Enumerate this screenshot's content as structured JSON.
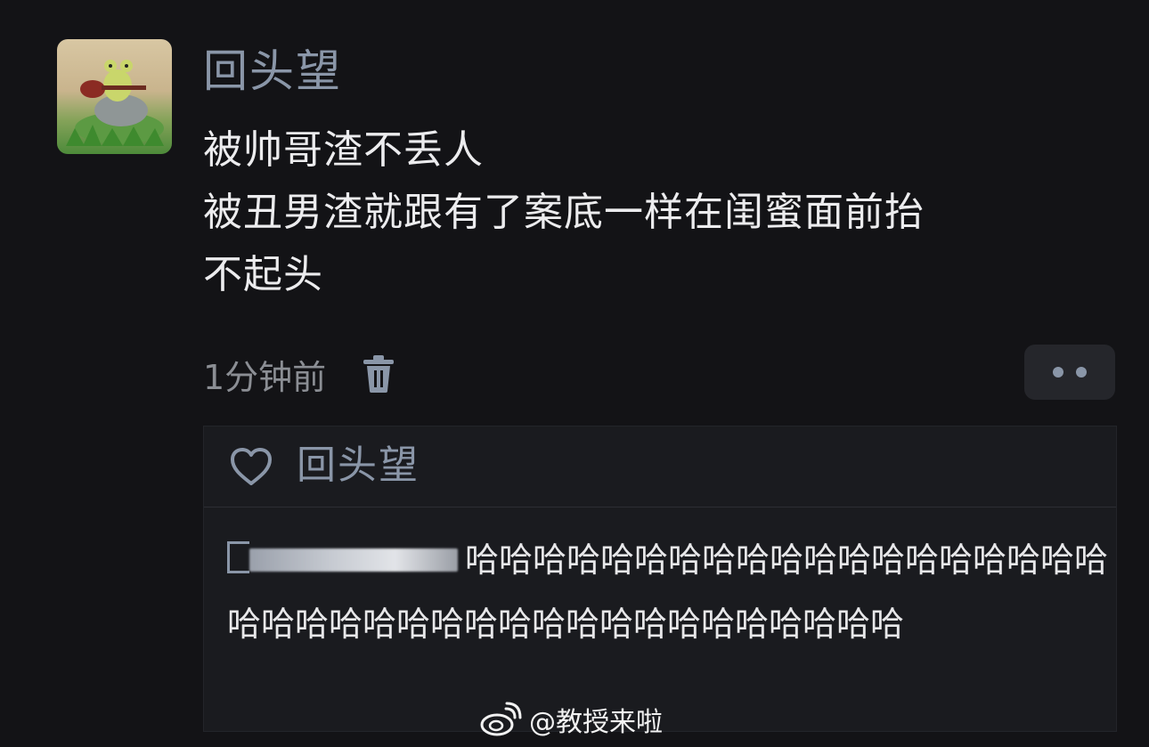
{
  "post": {
    "username": "回头望",
    "content_lines": [
      "被帅哥渣不丢人",
      "被丑男渣就跟有了案底一样在闺蜜面前抬",
      "不起头"
    ],
    "time": "1分钟前"
  },
  "reply_box": {
    "liked_by": "回头望",
    "text": "哈哈哈哈哈哈哈哈哈哈哈哈哈哈哈哈哈哈哈哈哈哈哈哈哈哈哈哈哈哈哈哈哈哈哈哈哈哈哈"
  },
  "watermark": {
    "text": "@教授来啦"
  },
  "colors": {
    "background": "#131316",
    "username": "#8a96a8",
    "text": "#ececee",
    "muted": "#8b8e94",
    "panel": "#1a1b1f"
  }
}
